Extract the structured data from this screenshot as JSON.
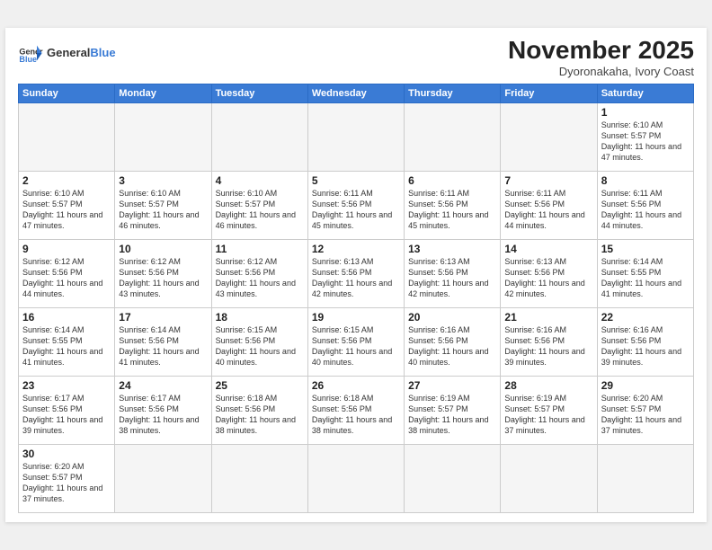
{
  "header": {
    "logo_general": "General",
    "logo_blue": "Blue",
    "month_title": "November 2025",
    "subtitle": "Dyoronakaha, Ivory Coast"
  },
  "weekdays": [
    "Sunday",
    "Monday",
    "Tuesday",
    "Wednesday",
    "Thursday",
    "Friday",
    "Saturday"
  ],
  "weeks": [
    [
      {
        "day": "",
        "info": ""
      },
      {
        "day": "",
        "info": ""
      },
      {
        "day": "",
        "info": ""
      },
      {
        "day": "",
        "info": ""
      },
      {
        "day": "",
        "info": ""
      },
      {
        "day": "",
        "info": ""
      },
      {
        "day": "1",
        "info": "Sunrise: 6:10 AM\nSunset: 5:57 PM\nDaylight: 11 hours\nand 47 minutes."
      }
    ],
    [
      {
        "day": "2",
        "info": "Sunrise: 6:10 AM\nSunset: 5:57 PM\nDaylight: 11 hours\nand 47 minutes."
      },
      {
        "day": "3",
        "info": "Sunrise: 6:10 AM\nSunset: 5:57 PM\nDaylight: 11 hours\nand 46 minutes."
      },
      {
        "day": "4",
        "info": "Sunrise: 6:10 AM\nSunset: 5:57 PM\nDaylight: 11 hours\nand 46 minutes."
      },
      {
        "day": "5",
        "info": "Sunrise: 6:11 AM\nSunset: 5:56 PM\nDaylight: 11 hours\nand 45 minutes."
      },
      {
        "day": "6",
        "info": "Sunrise: 6:11 AM\nSunset: 5:56 PM\nDaylight: 11 hours\nand 45 minutes."
      },
      {
        "day": "7",
        "info": "Sunrise: 6:11 AM\nSunset: 5:56 PM\nDaylight: 11 hours\nand 44 minutes."
      },
      {
        "day": "8",
        "info": "Sunrise: 6:11 AM\nSunset: 5:56 PM\nDaylight: 11 hours\nand 44 minutes."
      }
    ],
    [
      {
        "day": "9",
        "info": "Sunrise: 6:12 AM\nSunset: 5:56 PM\nDaylight: 11 hours\nand 44 minutes."
      },
      {
        "day": "10",
        "info": "Sunrise: 6:12 AM\nSunset: 5:56 PM\nDaylight: 11 hours\nand 43 minutes."
      },
      {
        "day": "11",
        "info": "Sunrise: 6:12 AM\nSunset: 5:56 PM\nDaylight: 11 hours\nand 43 minutes."
      },
      {
        "day": "12",
        "info": "Sunrise: 6:13 AM\nSunset: 5:56 PM\nDaylight: 11 hours\nand 42 minutes."
      },
      {
        "day": "13",
        "info": "Sunrise: 6:13 AM\nSunset: 5:56 PM\nDaylight: 11 hours\nand 42 minutes."
      },
      {
        "day": "14",
        "info": "Sunrise: 6:13 AM\nSunset: 5:56 PM\nDaylight: 11 hours\nand 42 minutes."
      },
      {
        "day": "15",
        "info": "Sunrise: 6:14 AM\nSunset: 5:55 PM\nDaylight: 11 hours\nand 41 minutes."
      }
    ],
    [
      {
        "day": "16",
        "info": "Sunrise: 6:14 AM\nSunset: 5:55 PM\nDaylight: 11 hours\nand 41 minutes."
      },
      {
        "day": "17",
        "info": "Sunrise: 6:14 AM\nSunset: 5:56 PM\nDaylight: 11 hours\nand 41 minutes."
      },
      {
        "day": "18",
        "info": "Sunrise: 6:15 AM\nSunset: 5:56 PM\nDaylight: 11 hours\nand 40 minutes."
      },
      {
        "day": "19",
        "info": "Sunrise: 6:15 AM\nSunset: 5:56 PM\nDaylight: 11 hours\nand 40 minutes."
      },
      {
        "day": "20",
        "info": "Sunrise: 6:16 AM\nSunset: 5:56 PM\nDaylight: 11 hours\nand 40 minutes."
      },
      {
        "day": "21",
        "info": "Sunrise: 6:16 AM\nSunset: 5:56 PM\nDaylight: 11 hours\nand 39 minutes."
      },
      {
        "day": "22",
        "info": "Sunrise: 6:16 AM\nSunset: 5:56 PM\nDaylight: 11 hours\nand 39 minutes."
      }
    ],
    [
      {
        "day": "23",
        "info": "Sunrise: 6:17 AM\nSunset: 5:56 PM\nDaylight: 11 hours\nand 39 minutes."
      },
      {
        "day": "24",
        "info": "Sunrise: 6:17 AM\nSunset: 5:56 PM\nDaylight: 11 hours\nand 38 minutes."
      },
      {
        "day": "25",
        "info": "Sunrise: 6:18 AM\nSunset: 5:56 PM\nDaylight: 11 hours\nand 38 minutes."
      },
      {
        "day": "26",
        "info": "Sunrise: 6:18 AM\nSunset: 5:56 PM\nDaylight: 11 hours\nand 38 minutes."
      },
      {
        "day": "27",
        "info": "Sunrise: 6:19 AM\nSunset: 5:57 PM\nDaylight: 11 hours\nand 38 minutes."
      },
      {
        "day": "28",
        "info": "Sunrise: 6:19 AM\nSunset: 5:57 PM\nDaylight: 11 hours\nand 37 minutes."
      },
      {
        "day": "29",
        "info": "Sunrise: 6:20 AM\nSunset: 5:57 PM\nDaylight: 11 hours\nand 37 minutes."
      }
    ],
    [
      {
        "day": "30",
        "info": "Sunrise: 6:20 AM\nSunset: 5:57 PM\nDaylight: 11 hours\nand 37 minutes."
      },
      {
        "day": "",
        "info": ""
      },
      {
        "day": "",
        "info": ""
      },
      {
        "day": "",
        "info": ""
      },
      {
        "day": "",
        "info": ""
      },
      {
        "day": "",
        "info": ""
      },
      {
        "day": "",
        "info": ""
      }
    ]
  ]
}
